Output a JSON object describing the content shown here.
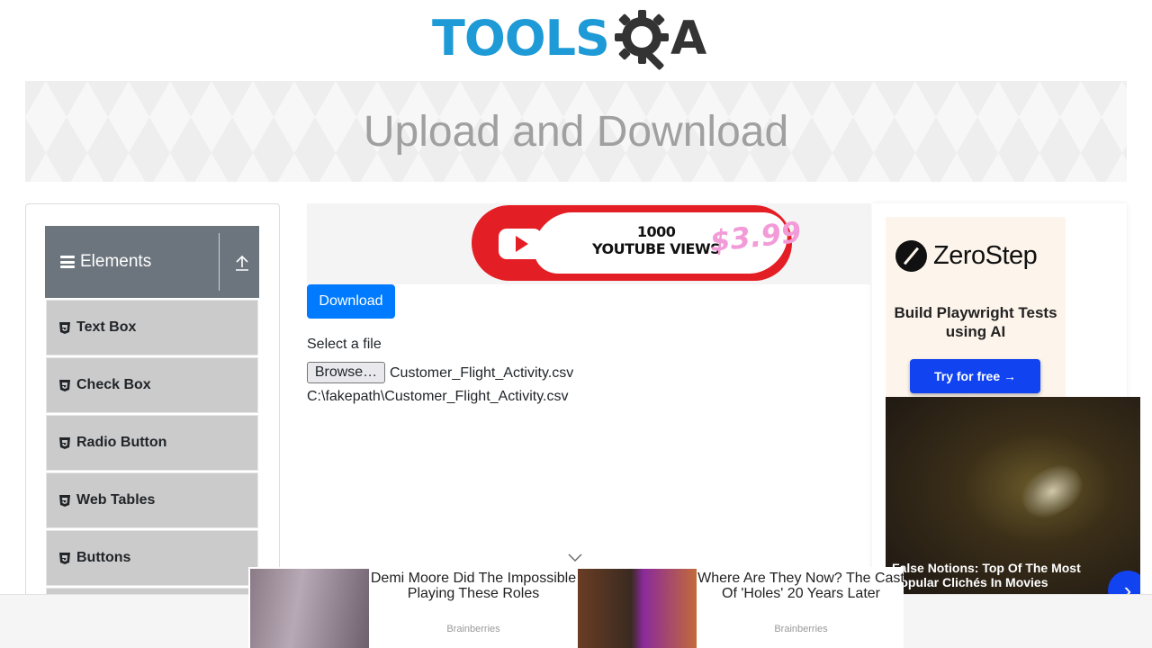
{
  "header": {
    "logo_text_left": "TOOLS",
    "logo_text_right": "A",
    "brand_color": "#1e9ad6"
  },
  "banner": {
    "title": "Upload and Download"
  },
  "sidebar": {
    "group_title": "Elements",
    "group_color": "#6c757d",
    "items": [
      {
        "label": "Text Box",
        "icon": "html5-shield-icon"
      },
      {
        "label": "Check Box",
        "icon": "html5-shield-icon"
      },
      {
        "label": "Radio Button",
        "icon": "html5-shield-icon"
      },
      {
        "label": "Web Tables",
        "icon": "html5-shield-icon"
      },
      {
        "label": "Buttons",
        "icon": "html5-shield-icon"
      }
    ]
  },
  "main": {
    "ad_top": {
      "line1": "1000",
      "line2": "YOUTUBE VIEWS",
      "price": "$3.99"
    },
    "download_button": "Download",
    "select_label": "Select a file",
    "browse_button": "Browse…",
    "selected_file": "Customer_Flight_Activity.csv",
    "uploaded_path": "C:\\fakepath\\Customer_Flight_Activity.csv"
  },
  "right_ad": {
    "brand": "ZeroStep",
    "subtitle": "Build Playwright Tests using AI",
    "cta": "Try for free →",
    "video_caption": "False Notions: Top Of The Most Popular Clichés In Movies"
  },
  "bottom_ads": [
    {
      "title": "Demi Moore Did The Impossible Playing These Roles",
      "source": "Brainberries"
    },
    {
      "title": "Where Are They Now? The Cast Of 'Holes' 20 Years Later",
      "source": "Brainberries"
    }
  ],
  "colors": {
    "primary_button": "#007bff",
    "menu_item_bg": "#cbcbcb",
    "cta_blue": "#1144f0"
  }
}
